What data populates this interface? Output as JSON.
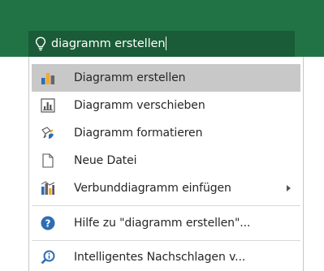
{
  "search": {
    "query": "diagramm erstellen",
    "icon": "lightbulb-icon"
  },
  "menu": {
    "items": [
      {
        "label": "Diagramm erstellen",
        "icon": "bar-chart-icon",
        "selected": true
      },
      {
        "label": "Diagramm verschieben",
        "icon": "move-chart-icon"
      },
      {
        "label": "Diagramm formatieren",
        "icon": "format-brush-icon"
      },
      {
        "label": "Neue Datei",
        "icon": "new-document-icon"
      },
      {
        "label": "Verbunddiagramm einfügen",
        "icon": "combo-chart-icon",
        "has_submenu": true
      },
      {
        "label": "Hilfe zu \"diagramm erstellen\"...",
        "icon": "help-icon"
      },
      {
        "label": "Intelligentes Nachschlagen v...",
        "icon": "smart-lookup-icon"
      }
    ]
  },
  "colors": {
    "ribbon": "#217346",
    "search_box": "#1a5c37",
    "selected_item": "#c8c8c8",
    "help_icon": "#2e6db4"
  }
}
